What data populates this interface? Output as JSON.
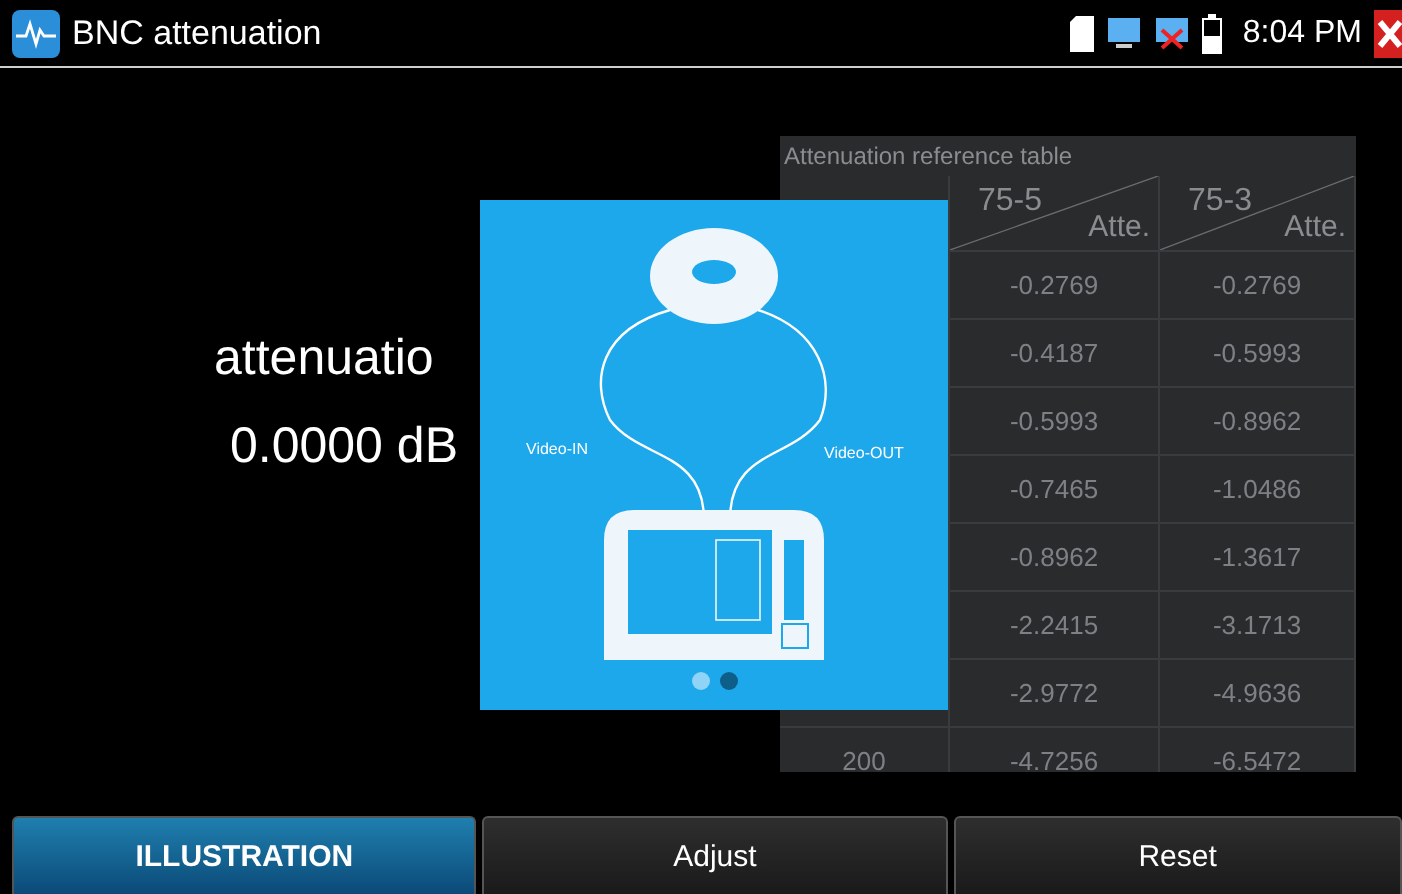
{
  "window": {
    "title": "BNC attenuation",
    "time": "8:04 PM"
  },
  "measurement": {
    "label": "attenuatio",
    "value": "0.0000 dB"
  },
  "reference_table": {
    "title": "Attenuation reference table",
    "columns": [
      {
        "name": "75-5",
        "unit": "Atte."
      },
      {
        "name": "75-3",
        "unit": "Atte."
      }
    ],
    "rows": [
      {
        "length": "",
        "values": [
          "-0.2769",
          "-0.2769"
        ]
      },
      {
        "length": "",
        "values": [
          "-0.4187",
          "-0.5993"
        ]
      },
      {
        "length": "",
        "values": [
          "-0.5993",
          "-0.8962"
        ]
      },
      {
        "length": "",
        "values": [
          "-0.7465",
          "-1.0486"
        ]
      },
      {
        "length": "",
        "values": [
          "-0.8962",
          "-1.3617"
        ]
      },
      {
        "length": "",
        "values": [
          "-2.2415",
          "-3.1713"
        ]
      },
      {
        "length": "",
        "values": [
          "-2.9772",
          "-4.9636"
        ]
      },
      {
        "length": "200",
        "values": [
          "-4.7256",
          "-6.5472"
        ]
      }
    ]
  },
  "illustration": {
    "input_label": "Video-IN",
    "output_label": "Video-OUT",
    "pages": [
      {
        "selected": false
      },
      {
        "selected": true
      }
    ]
  },
  "buttons": [
    {
      "label": "ILLUSTRATION",
      "selected": true
    },
    {
      "label": "Adjust",
      "selected": false
    },
    {
      "label": "Reset",
      "selected": false
    }
  ]
}
